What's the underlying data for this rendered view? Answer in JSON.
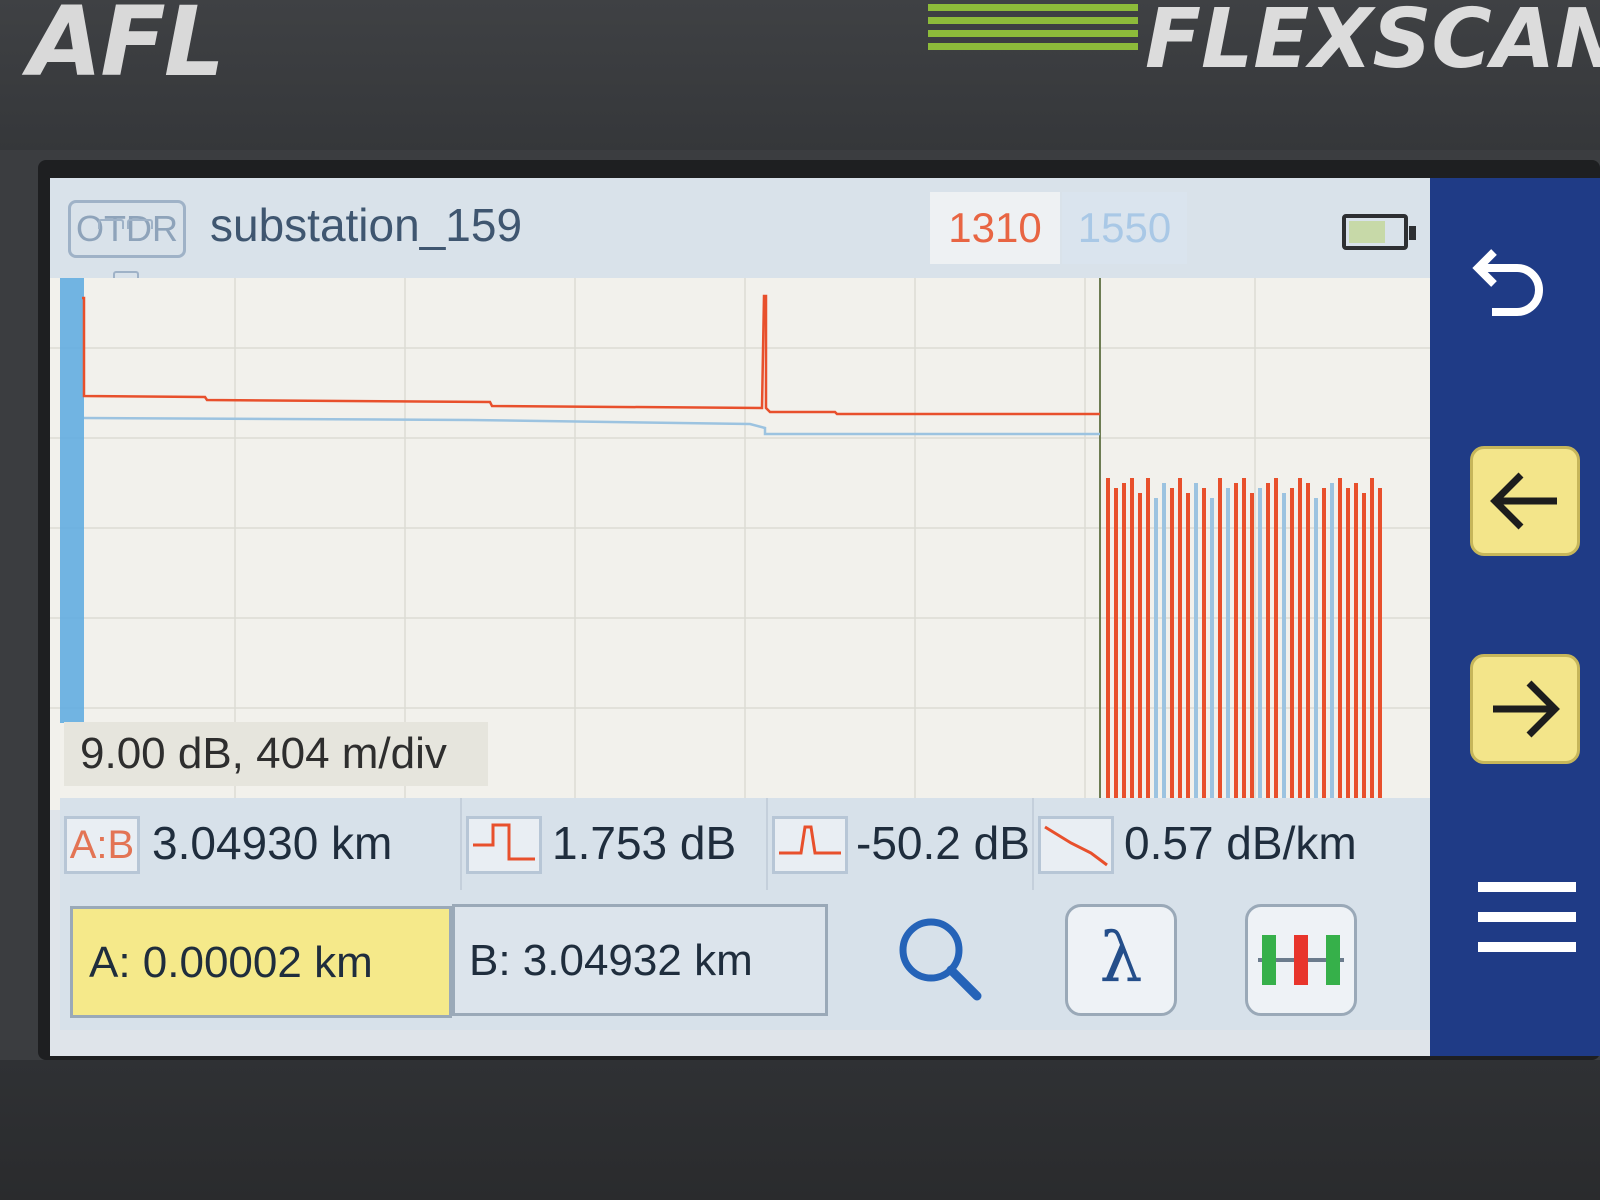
{
  "device": {
    "brand": "AFL",
    "product": "FLEXSCAN"
  },
  "header": {
    "mode_badge": "OTDR",
    "file_name": "substation_159",
    "wavelengths": [
      "1310",
      "1550"
    ],
    "active_wavelength": "1310",
    "battery_icon": "battery-icon"
  },
  "trace": {
    "scale_label": "9.00 dB, 404 m/div",
    "colors": {
      "trace_1310": "#e8502c",
      "trace_1550": "#9cc3e0",
      "cursor_a": "#4aa3e0",
      "cursor_b": "#e8502c"
    }
  },
  "measurements": {
    "ab_icon_label": "A:B",
    "distance": "3.04930 km",
    "loss": "1.753 dB",
    "reflectance": "-50.2 dB",
    "attenuation": "0.57 dB/km"
  },
  "cursors": {
    "a_value": "A: 0.00002 km",
    "b_value": "B: 3.04932 km"
  },
  "toolbar": {
    "lambda_label": "λ"
  },
  "icons": {
    "back": "back-arrow-icon",
    "left": "arrow-left-icon",
    "right": "arrow-right-icon",
    "menu": "hamburger-menu-icon",
    "zoom": "magnifier-icon",
    "events": "event-table-icon",
    "loss": "splice-loss-icon",
    "reflectance": "reflectance-icon",
    "attenuation": "attenuation-icon"
  }
}
